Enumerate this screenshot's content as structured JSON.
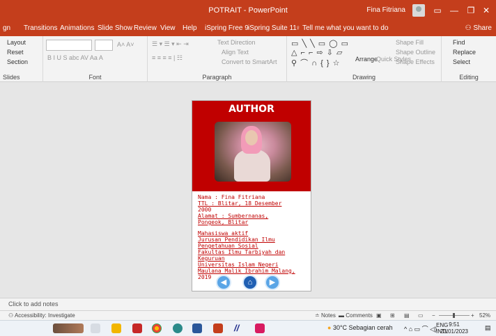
{
  "window": {
    "title": "POTRAIT - PowerPoint",
    "user": "Fina Fitriana",
    "minimize": "—",
    "restore": "❐",
    "close": "✕"
  },
  "tabs": [
    "gn",
    "Transitions",
    "Animations",
    "Slide Show",
    "Review",
    "View",
    "Help",
    "iSpring Free 9",
    "iSpring Suite 11"
  ],
  "tell_me": "Tell me what you want to do",
  "share": "Share",
  "ribbon": {
    "slides": {
      "label": "Slides",
      "items": [
        "Layout",
        "Reset",
        "Section"
      ]
    },
    "font": {
      "label": "Font",
      "font_name": "",
      "font_size": "",
      "format_row": "B  I  U  S  abc  AV  Aa  A"
    },
    "paragraph": {
      "label": "Paragraph",
      "items": [
        "Text Direction",
        "Align Text",
        "Convert to SmartArt"
      ]
    },
    "drawing": {
      "label": "Drawing",
      "items": [
        "Shape Fill",
        "Shape Outline",
        "Shape Effects",
        "Arrange",
        "Quick Styles"
      ]
    },
    "editing": {
      "label": "Editing",
      "items": [
        "Find",
        "Replace",
        "Select"
      ]
    }
  },
  "slide": {
    "title": "AUTHOR",
    "info_lines": [
      "Nama    : Fina Fitriana",
      "TTL     : Blitar, 18 Desember",
      "2000",
      "Alamat  : Sumbernanas,",
      "Pongeok, Blitar",
      "",
      "Mahasiswa aktif",
      "Jurusan Pendidikan Ilmu",
      "Pengetahuan Sosial",
      "Fakultas Ilmu Tarbiyah dan",
      "Keguruan",
      "Universitas Islam Negeri",
      "Maulana Malik Ibrahim Malang,",
      "2019"
    ],
    "nav": [
      "◀",
      "⌂",
      "▶"
    ]
  },
  "notes_placeholder": "Click to add notes",
  "status": {
    "accessibility": "Accessibility: Investigate",
    "notes": "Notes",
    "comments": "Comments",
    "zoom": "52%",
    "zoom_minus": "−",
    "zoom_plus": "+"
  },
  "taskbar": {
    "weather": "30°C  Sebagian cerah",
    "lang": "ENG",
    "lang_sub": "INTL",
    "time": "9:51",
    "date": "23/01/2023"
  },
  "colors": {
    "accent": "#c43e1c",
    "slide_red": "#c00000",
    "nav_blue": "#5aa5e6"
  }
}
